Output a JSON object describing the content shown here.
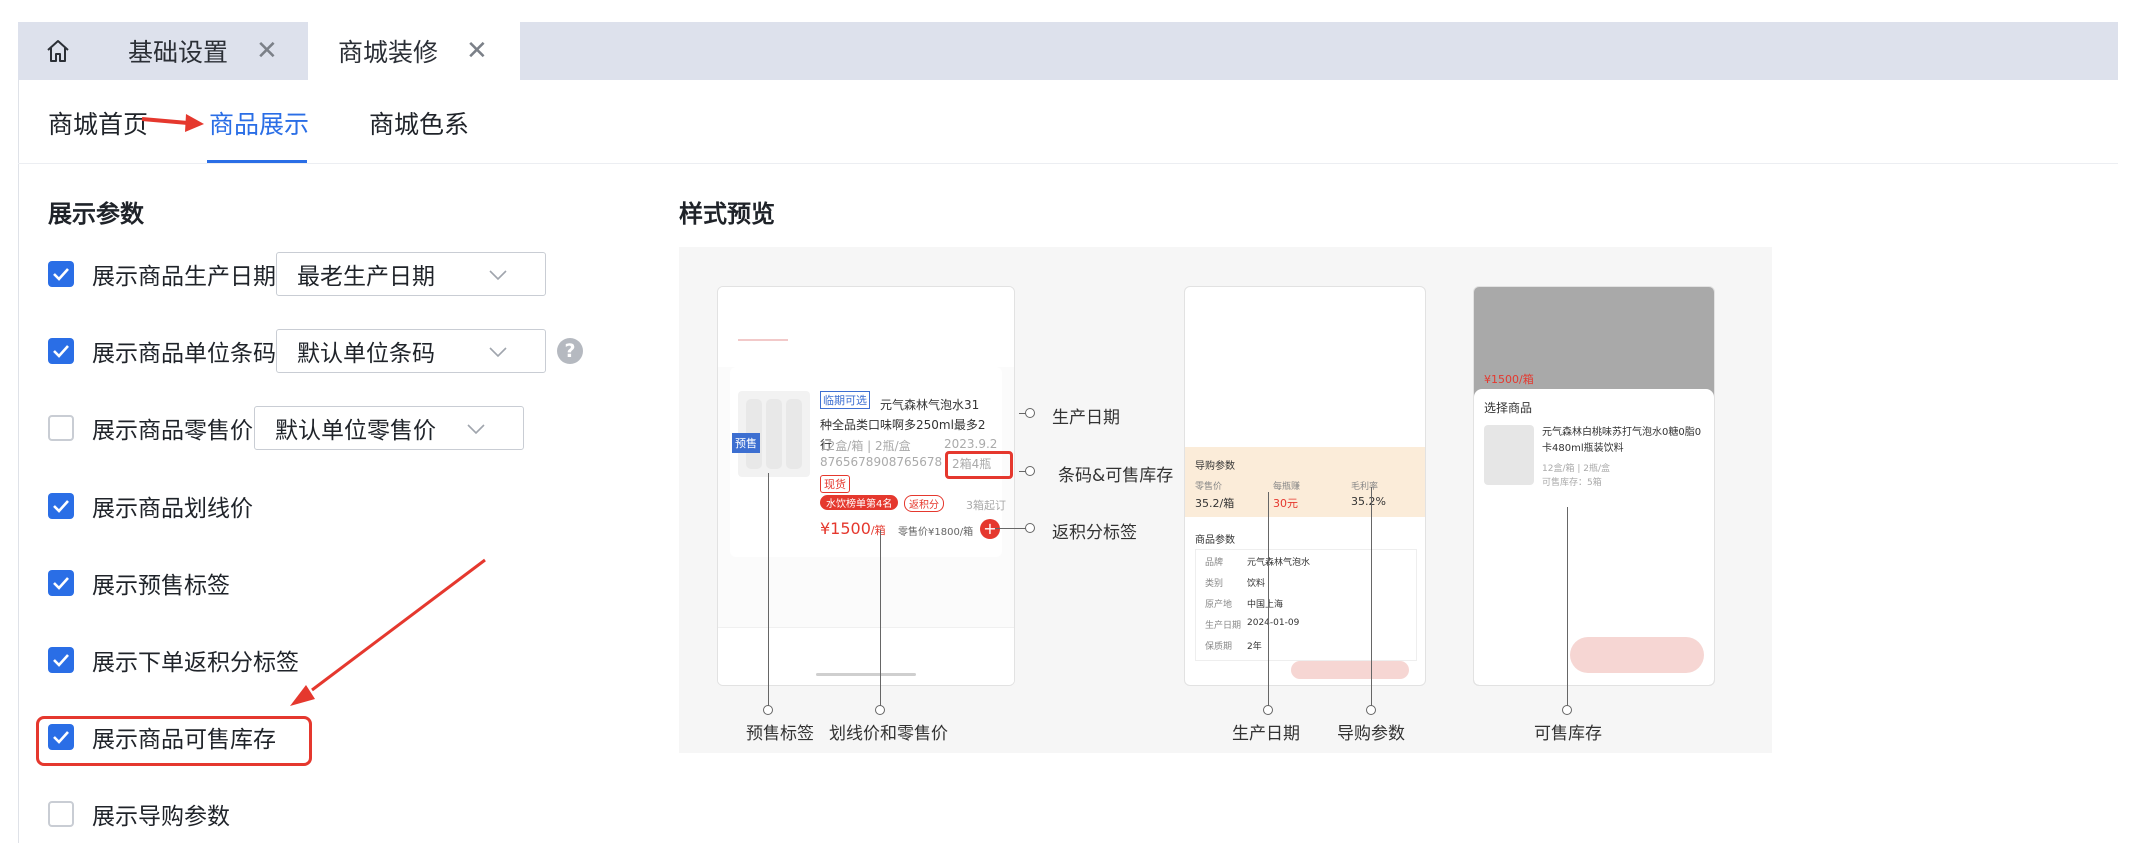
{
  "tabs": {
    "home_icon": "home-icon",
    "items": [
      {
        "label": "基础设置",
        "close": "✕"
      },
      {
        "label": "商城装修",
        "close": "✕"
      }
    ]
  },
  "subnav": [
    "商城首页",
    "商品展示",
    "商城色系"
  ],
  "params": {
    "title": "展示参数",
    "rows": [
      {
        "label": "展示商品生产日期",
        "checked": true,
        "select": "最老生产日期"
      },
      {
        "label": "展示商品单位条码",
        "checked": true,
        "select": "默认单位条码",
        "help": "?"
      },
      {
        "label": "展示商品零售价",
        "checked": false,
        "select": "默认单位零售价"
      },
      {
        "label": "展示商品划线价",
        "checked": true
      },
      {
        "label": "展示预售标签",
        "checked": true
      },
      {
        "label": "展示下单返积分标签",
        "checked": true
      },
      {
        "label": "展示商品可售库存",
        "checked": true
      },
      {
        "label": "展示导购参数",
        "checked": false
      }
    ]
  },
  "preview": {
    "title": "样式预览",
    "phone1": {
      "tag": "临期可选",
      "name": "元气森林气泡水31种全品类口味啊多250ml最多2行",
      "spec": "12盒/箱 | 2瓶/盒",
      "barcode": "8765678908765678",
      "date": "2023.9.2",
      "stock": "2箱4瓶",
      "presale": "预售",
      "spot": "现货",
      "badge": "水饮榜单第4名",
      "points": "返积分",
      "min_order": "3箱起订",
      "price": "¥1500",
      "price_unit": "/箱",
      "retail": "零售价¥1800/箱",
      "add": "+"
    },
    "phone2": {
      "params_title": "导购参数",
      "cols": [
        "零售价",
        "每瓶赚",
        "毛利率"
      ],
      "vals": [
        "35.2/箱",
        "30元",
        "35.2%"
      ],
      "info_title": "商品参数",
      "info": [
        {
          "k": "品牌",
          "v": "元气森林气泡水"
        },
        {
          "k": "类别",
          "v": "饮料"
        },
        {
          "k": "原产地",
          "v": "中国上海"
        },
        {
          "k": "生产日期",
          "v": "2024-01-09"
        },
        {
          "k": "保质期",
          "v": "2年"
        }
      ]
    },
    "phone3": {
      "modal_title": "选择商品",
      "name": "元气森林白桃味苏打气泡水0糖0脂0卡480ml瓶装饮料",
      "spec": "12盒/箱 | 2瓶/盒",
      "stock": "可售库存：5箱",
      "price": "¥1500/箱"
    },
    "callouts": {
      "production_date": "生产日期",
      "barcode_stock": "条码&可售库存",
      "points_tag": "返积分标签",
      "presale_tag": "预售标签",
      "strike_retail": "划线价和零售价",
      "production_date_2": "生产日期",
      "guide_params": "导购参数",
      "stock": "可售库存"
    }
  },
  "colors": {
    "accent": "#2a6ee6",
    "annotation_red": "#e5382e",
    "tabbar": "#dde1ec"
  }
}
